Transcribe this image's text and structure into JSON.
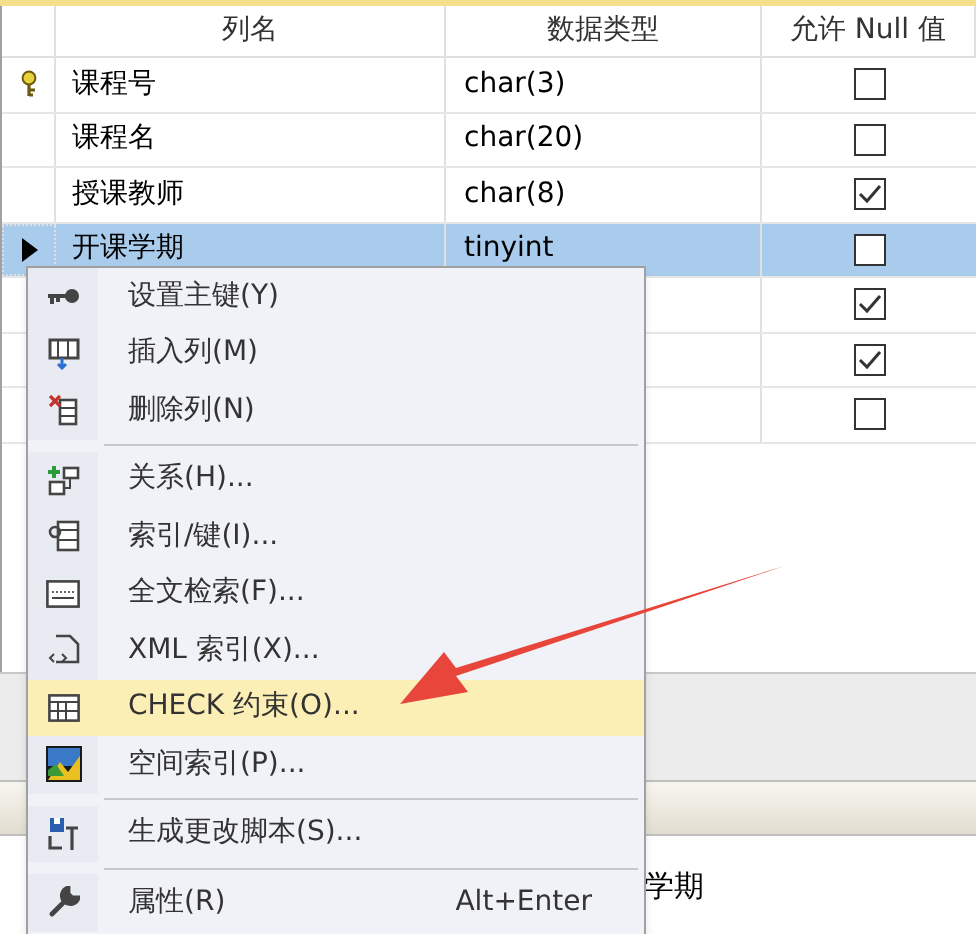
{
  "table": {
    "columns": [
      "列名",
      "数据类型",
      "允许 Null 值"
    ],
    "rows": [
      {
        "primary_key": true,
        "current": false,
        "selected": false,
        "name": "课程号",
        "type": "char(3)",
        "allow_null": false
      },
      {
        "primary_key": false,
        "current": false,
        "selected": false,
        "name": "课程名",
        "type": "char(20)",
        "allow_null": false
      },
      {
        "primary_key": false,
        "current": false,
        "selected": false,
        "name": "授课教师",
        "type": "char(8)",
        "allow_null": true
      },
      {
        "primary_key": false,
        "current": true,
        "selected": true,
        "name": "开课学期",
        "type": "tinyint",
        "allow_null": false
      },
      {
        "primary_key": false,
        "current": false,
        "selected": false,
        "allow_null": true
      },
      {
        "primary_key": false,
        "current": false,
        "selected": false,
        "allow_null": true
      },
      {
        "primary_key": false,
        "current": false,
        "selected": false,
        "allow_null": false
      }
    ]
  },
  "bottom_panel": {
    "text": "学期"
  },
  "context_menu": {
    "items": [
      {
        "kind": "item",
        "label": "设置主键(Y)",
        "selected": false
      },
      {
        "kind": "item",
        "label": "插入列(M)",
        "selected": false
      },
      {
        "kind": "item",
        "label": "删除列(N)",
        "selected": false
      },
      {
        "kind": "separator"
      },
      {
        "kind": "item",
        "label": "关系(H)...",
        "selected": false
      },
      {
        "kind": "item",
        "label": "索引/键(I)...",
        "selected": false
      },
      {
        "kind": "item",
        "label": "全文检索(F)...",
        "selected": false
      },
      {
        "kind": "item",
        "label": "XML 索引(X)...",
        "selected": false
      },
      {
        "kind": "item",
        "label": "CHECK 约束(O)...",
        "selected": true
      },
      {
        "kind": "item",
        "label": "空间索引(P)...",
        "selected": false
      },
      {
        "kind": "separator"
      },
      {
        "kind": "item",
        "label": "生成更改脚本(S)...",
        "selected": false
      },
      {
        "kind": "separator"
      },
      {
        "kind": "item",
        "label": "属性(R)",
        "shortcut": "Alt+Enter",
        "selected": false
      }
    ]
  }
}
